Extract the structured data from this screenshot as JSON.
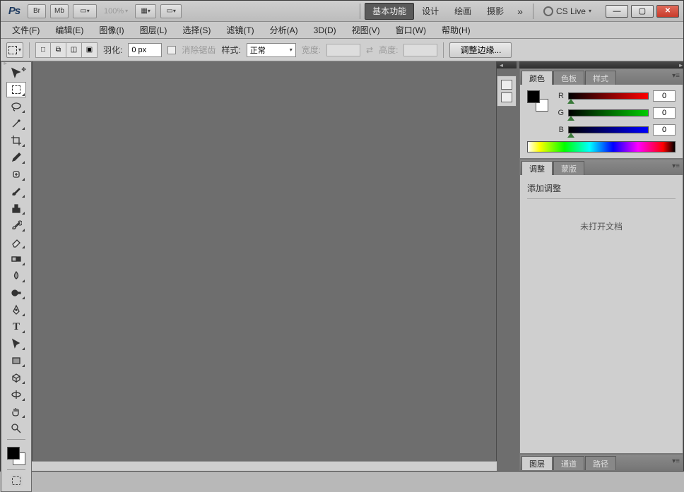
{
  "appbar": {
    "logo": "Ps",
    "btn_br": "Br",
    "btn_mb": "Mb",
    "zoom": "100%",
    "workspace_tabs": [
      "基本功能",
      "设计",
      "绘画",
      "摄影"
    ],
    "ws_more": "»",
    "cslive": "CS Live",
    "win_min": "—",
    "win_max": "▢"
  },
  "menu": {
    "items": [
      "文件(F)",
      "编辑(E)",
      "图像(I)",
      "图层(L)",
      "选择(S)",
      "滤镜(T)",
      "分析(A)",
      "3D(D)",
      "视图(V)",
      "窗口(W)",
      "帮助(H)"
    ]
  },
  "optbar": {
    "feather_label": "羽化:",
    "feather_value": "0 px",
    "antialias": "消除锯齿",
    "style_label": "样式:",
    "style_value": "正常",
    "width_label": "宽度:",
    "height_label": "高度:",
    "refine": "调整边缘..."
  },
  "panels": {
    "color": {
      "tabs": [
        "颜色",
        "色板",
        "样式"
      ],
      "r_label": "R",
      "r_val": "0",
      "g_label": "G",
      "g_val": "0",
      "b_label": "B",
      "b_val": "0"
    },
    "adjust": {
      "tabs": [
        "调整",
        "蒙版"
      ],
      "title": "添加调整",
      "msg": "未打开文档"
    },
    "layers": {
      "tabs": [
        "图层",
        "通道",
        "路径"
      ]
    }
  }
}
